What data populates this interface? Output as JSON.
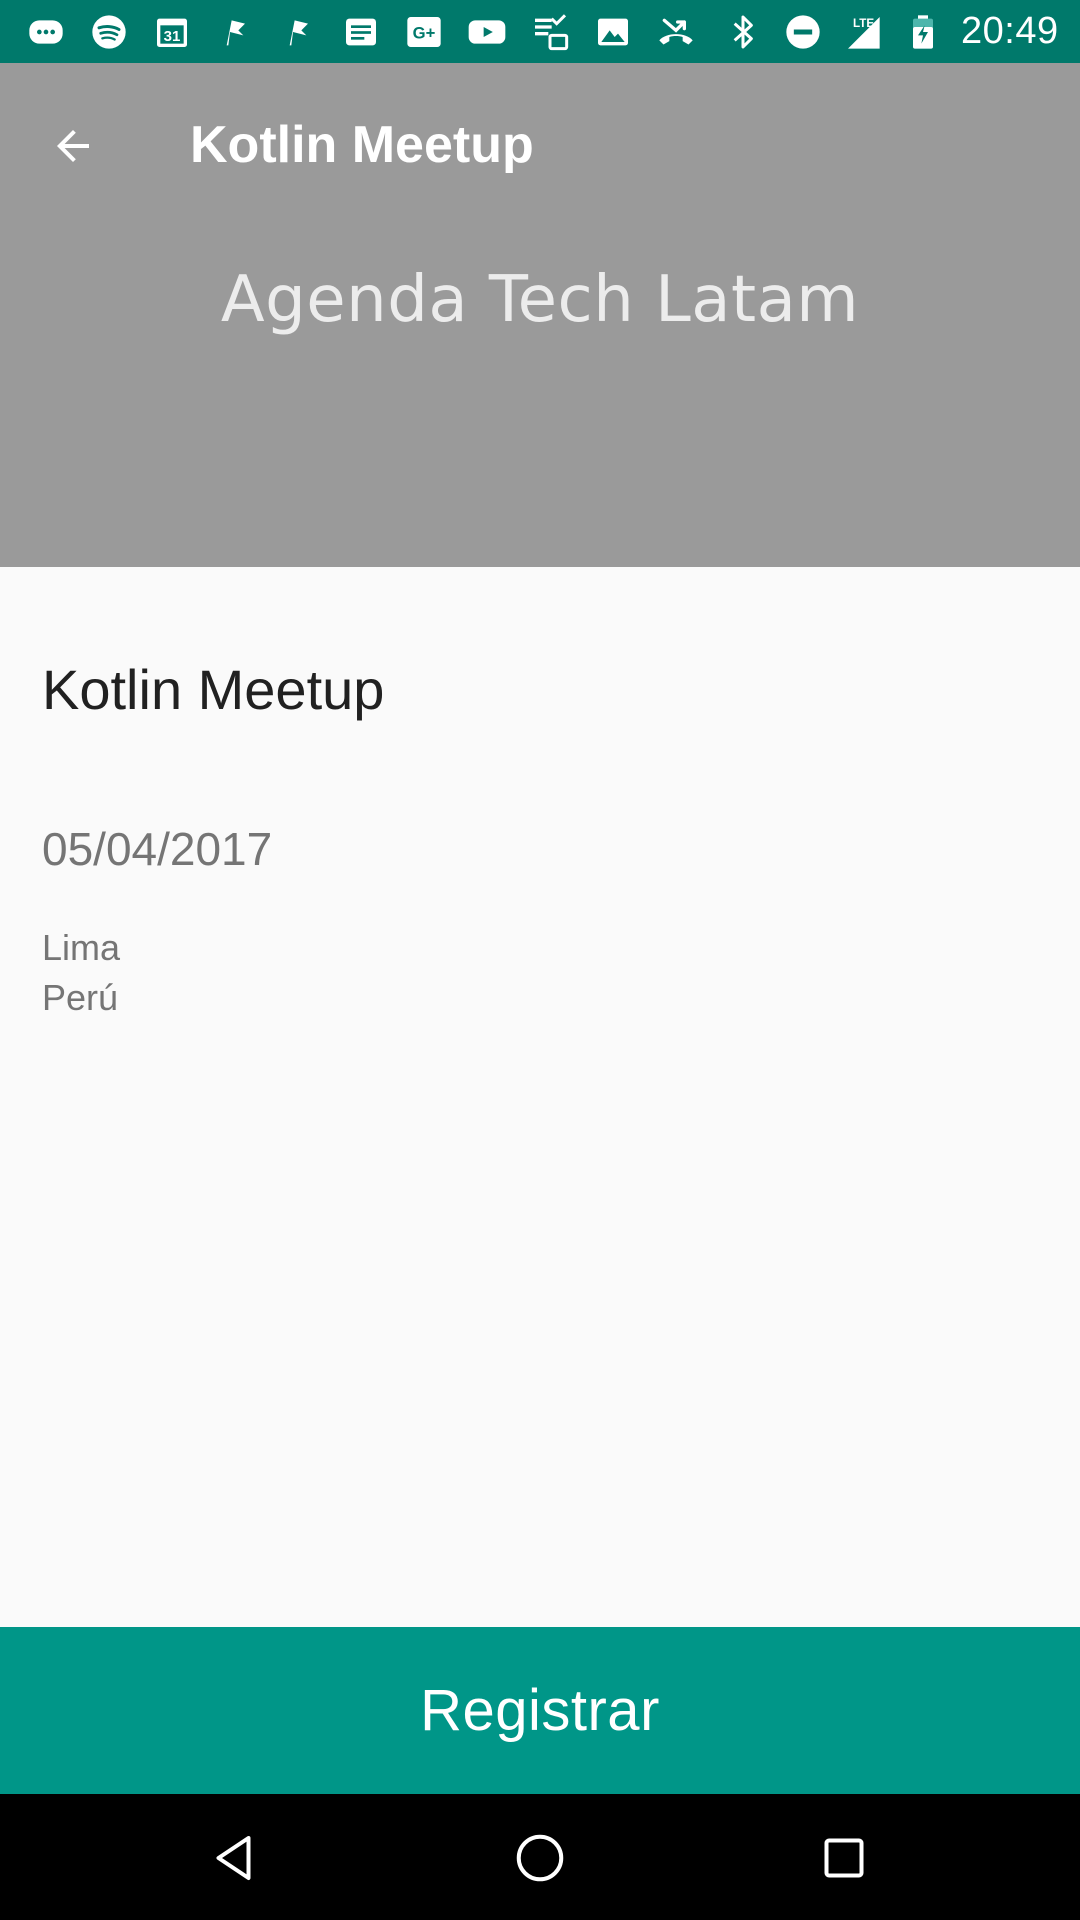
{
  "status_bar": {
    "time": "20:49",
    "icons": [
      "messages-icon",
      "spotify-icon",
      "calendar-icon",
      "flag-icon",
      "flag-icon",
      "news-icon",
      "google-plus-icon",
      "youtube-icon",
      "sync-icon",
      "photos-icon",
      "missed-call-icon",
      "bluetooth-icon",
      "do-not-disturb-icon",
      "lte-signal-icon",
      "battery-icon"
    ],
    "calendar_day": "31",
    "google_plus_label": "G+",
    "lte_label": "LTE",
    "background_color": "#00796b"
  },
  "toolbar": {
    "title": "Kotlin Meetup",
    "back_icon": "arrow-back-icon",
    "background_color": "#9a9a9a"
  },
  "hero": {
    "image_text": "Agenda Tech Latam"
  },
  "event": {
    "title": "Kotlin Meetup",
    "date": "05/04/2017",
    "city": "Lima",
    "country": "Perú"
  },
  "actions": {
    "register_label": "Registrar",
    "register_color": "#009688"
  },
  "nav_bar": {
    "icons": [
      "nav-back-icon",
      "nav-home-icon",
      "nav-recents-icon"
    ]
  }
}
